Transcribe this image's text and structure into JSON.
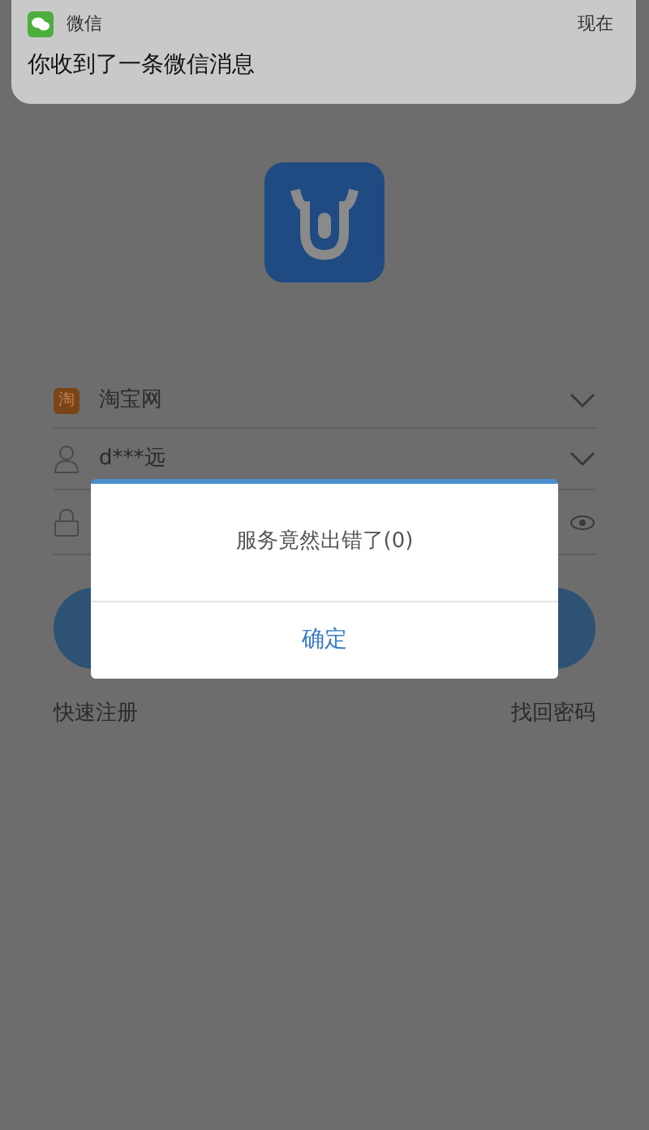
{
  "notification": {
    "app": "微信",
    "time": "现在",
    "message": "你收到了一条微信消息"
  },
  "login": {
    "platform_icon": "淘",
    "platform": "淘宝网",
    "username": "d***远"
  },
  "links": {
    "register": "快速注册",
    "forgot": "找回密码"
  },
  "dialog": {
    "message": "服务竟然出错了(0)",
    "button": "确定"
  }
}
